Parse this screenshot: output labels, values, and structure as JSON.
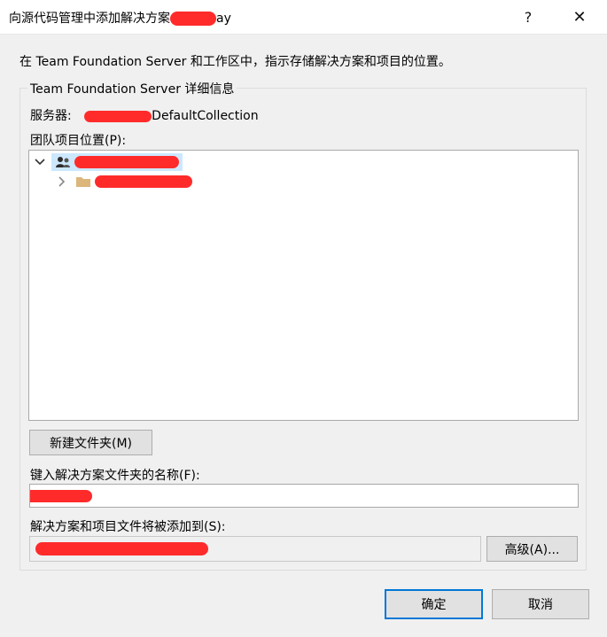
{
  "window": {
    "title_prefix": "向源代码管理中添加解决方案",
    "title_suffix": "ay",
    "help_glyph": "?",
    "close_glyph": "✕"
  },
  "instruction": "在 Team Foundation Server 和工作区中，指示存储解决方案和项目的位置。",
  "details_group": {
    "title": "Team Foundation Server 详细信息",
    "server_label": "服务器:",
    "server_value_suffix": "DefaultCollection"
  },
  "team_project": {
    "label": "团队项目位置(P):",
    "tree": [
      {
        "label": "",
        "expanded": true,
        "selected": true,
        "icon": "team-collection-icon"
      },
      {
        "label": "",
        "expanded": false,
        "selected": false,
        "icon": "folder-icon"
      }
    ]
  },
  "new_folder_button": "新建文件夹(M)",
  "solution_folder": {
    "label": "键入解决方案文件夹的名称(F):",
    "value": ""
  },
  "destination": {
    "label": "解决方案和项目文件将被添加到(S):",
    "value": "",
    "advanced_button": "高级(A)..."
  },
  "buttons": {
    "ok": "确定",
    "cancel": "取消"
  },
  "colors": {
    "accent": "#0078d7",
    "selection": "#cce8ff",
    "redaction": "#ff2b2b"
  }
}
